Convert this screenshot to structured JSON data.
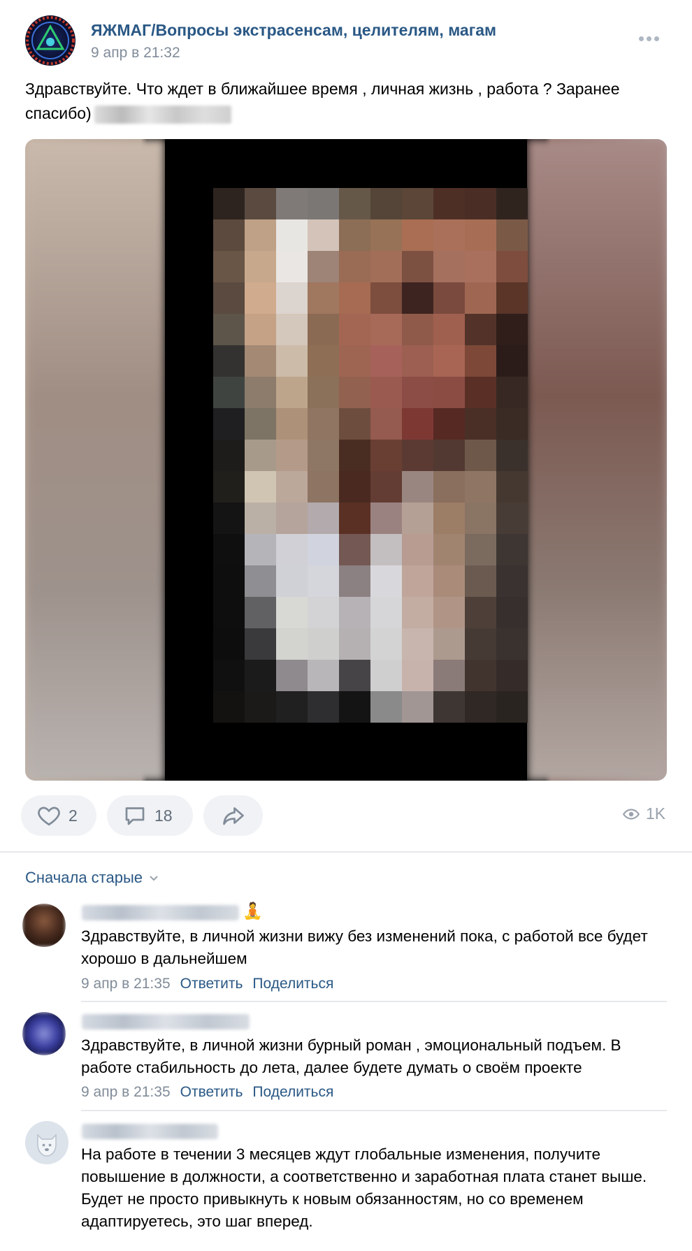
{
  "post": {
    "group_name": "ЯЖМАГ/Вопросы экстрасенсам, целителям, магам",
    "date": "9 апр в 21:32",
    "text": "Здравствуйте. Что ждет в ближайшее время , личная жизнь , работа ? Заранее спасибо)",
    "more_icon": "more-horizontal-icon"
  },
  "actions": {
    "likes": "2",
    "comments": "18",
    "views": "1K"
  },
  "comments_section": {
    "sort_label": "Сначала старые",
    "items": [
      {
        "emoji": "🧘",
        "text": "Здравствуйте, в личной жизни вижу без изменений пока, с работой все будет хорошо в дальнейшем",
        "date": "9 апр в 21:35",
        "reply": "Ответить",
        "share": "Поделиться"
      },
      {
        "text": "Здравствуйте, в личной жизни бурный роман , эмоциональный подъем. В работе стабильность до лета, далее будете думать о своём проекте",
        "date": "9 апр в 21:35",
        "reply": "Ответить",
        "share": "Поделиться"
      },
      {
        "text": "На работе в течении 3 месяцев ждут глобальные изменения, получите повышение в должности, а соответственно и заработная плата станет выше. Будет не просто привыкнуть к новым обязанностям, но со временем адаптируетесь, это шаг вперед."
      }
    ]
  },
  "colors": {
    "link": "#2a5885",
    "meta": "#818c99",
    "pill_bg": "#f0f2f5"
  }
}
